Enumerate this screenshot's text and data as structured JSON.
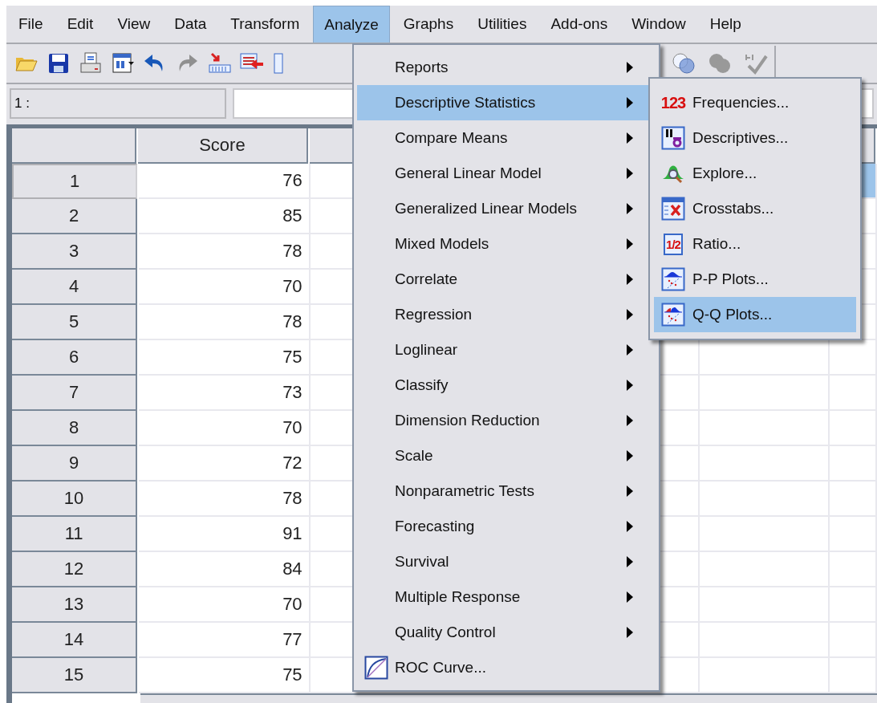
{
  "menu_bar": [
    {
      "label": "File",
      "selected": false
    },
    {
      "label": "Edit",
      "selected": false
    },
    {
      "label": "View",
      "selected": false
    },
    {
      "label": "Data",
      "selected": false
    },
    {
      "label": "Transform",
      "selected": false
    },
    {
      "label": "Analyze",
      "selected": true
    },
    {
      "label": "Graphs",
      "selected": false
    },
    {
      "label": "Utilities",
      "selected": false
    },
    {
      "label": "Add-ons",
      "selected": false
    },
    {
      "label": "Window",
      "selected": false
    },
    {
      "label": "Help",
      "selected": false
    }
  ],
  "cell_bar": {
    "reference": "1 :"
  },
  "data_grid": {
    "columns": [
      "Score"
    ],
    "rows": [
      {
        "label": "1",
        "score": "76",
        "selected": true
      },
      {
        "label": "2",
        "score": "85",
        "selected": false
      },
      {
        "label": "3",
        "score": "78",
        "selected": false
      },
      {
        "label": "4",
        "score": "70",
        "selected": false
      },
      {
        "label": "5",
        "score": "78",
        "selected": false
      },
      {
        "label": "6",
        "score": "75",
        "selected": false
      },
      {
        "label": "7",
        "score": "73",
        "selected": false
      },
      {
        "label": "8",
        "score": "70",
        "selected": false
      },
      {
        "label": "9",
        "score": "72",
        "selected": false
      },
      {
        "label": "10",
        "score": "78",
        "selected": false
      },
      {
        "label": "11",
        "score": "91",
        "selected": false
      },
      {
        "label": "12",
        "score": "84",
        "selected": false
      },
      {
        "label": "13",
        "score": "70",
        "selected": false
      },
      {
        "label": "14",
        "score": "77",
        "selected": false
      },
      {
        "label": "15",
        "score": "75",
        "selected": false
      }
    ]
  },
  "analyze_menu": [
    {
      "label": "Reports",
      "submenu": true,
      "selected": false
    },
    {
      "label": "Descriptive Statistics",
      "submenu": true,
      "selected": true
    },
    {
      "label": "Compare Means",
      "submenu": true,
      "selected": false
    },
    {
      "label": "General Linear Model",
      "submenu": true,
      "selected": false
    },
    {
      "label": "Generalized Linear Models",
      "submenu": true,
      "selected": false
    },
    {
      "label": "Mixed Models",
      "submenu": true,
      "selected": false
    },
    {
      "label": "Correlate",
      "submenu": true,
      "selected": false
    },
    {
      "label": "Regression",
      "submenu": true,
      "selected": false
    },
    {
      "label": "Loglinear",
      "submenu": true,
      "selected": false
    },
    {
      "label": "Classify",
      "submenu": true,
      "selected": false
    },
    {
      "label": "Dimension Reduction",
      "submenu": true,
      "selected": false
    },
    {
      "label": "Scale",
      "submenu": true,
      "selected": false
    },
    {
      "label": "Nonparametric Tests",
      "submenu": true,
      "selected": false
    },
    {
      "label": "Forecasting",
      "submenu": true,
      "selected": false
    },
    {
      "label": "Survival",
      "submenu": true,
      "selected": false
    },
    {
      "label": "Multiple Response",
      "submenu": true,
      "selected": false
    },
    {
      "label": "Quality Control",
      "submenu": true,
      "selected": false
    },
    {
      "label": "ROC Curve...",
      "submenu": false,
      "selected": false
    }
  ],
  "descriptive_submenu": [
    {
      "label": "Frequencies...",
      "icon_text": "123",
      "selected": false
    },
    {
      "label": "Descriptives...",
      "selected": false
    },
    {
      "label": "Explore...",
      "selected": false
    },
    {
      "label": "Crosstabs...",
      "selected": false
    },
    {
      "label": "Ratio...",
      "icon_text": "1/2",
      "selected": false
    },
    {
      "label": "P-P Plots...",
      "selected": false
    },
    {
      "label": "Q-Q Plots...",
      "selected": true
    }
  ]
}
